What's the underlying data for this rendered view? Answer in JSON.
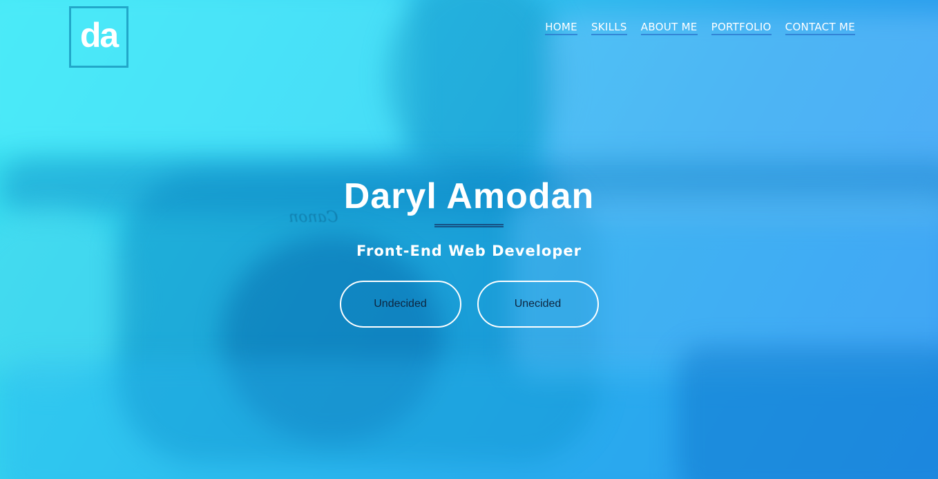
{
  "logo": {
    "text": "da"
  },
  "nav": {
    "items": [
      {
        "label": "HOME"
      },
      {
        "label": "SKILLS"
      },
      {
        "label": "ABOUT ME"
      },
      {
        "label": "PORTFOLIO"
      },
      {
        "label": "CONTACT ME"
      }
    ]
  },
  "hero": {
    "name": "Daryl Amodan",
    "subtitle": "Front-End Web Developer",
    "buttons": [
      {
        "label": "Undecided"
      },
      {
        "label": "Unecided"
      }
    ],
    "background_photo_text": "Canon"
  },
  "colors": {
    "gradient_start": "#3ae4f0",
    "gradient_end": "#2d8ef0",
    "text": "#ffffff",
    "button_text": "#0d2640",
    "logo_border": "#22a7c9"
  }
}
